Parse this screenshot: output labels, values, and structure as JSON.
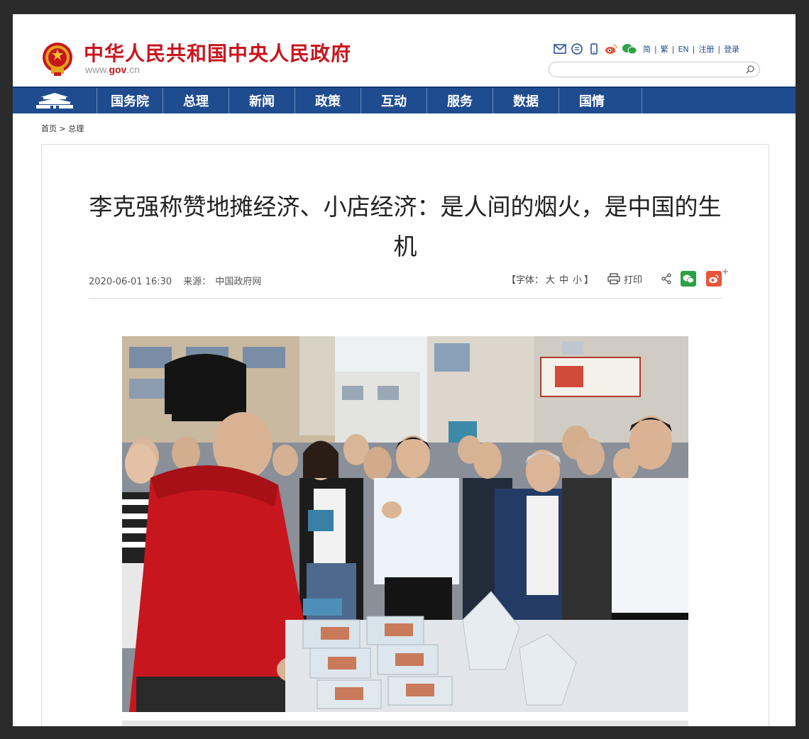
{
  "header": {
    "site_title": "中华人民共和国中央人民政府",
    "site_url_prefix": "www.",
    "site_url_gov": "gov",
    "site_url_suffix": ".cn",
    "tool_icons": [
      "mail-icon",
      "rss-icon",
      "mobile-icon",
      "weibo-icon",
      "wechat-icon"
    ],
    "links": [
      "简",
      "繁",
      "EN",
      "注册",
      "登录"
    ],
    "search_placeholder": ""
  },
  "nav": {
    "items": [
      "国务院",
      "总理",
      "新闻",
      "政策",
      "互动",
      "服务",
      "数据",
      "国情"
    ]
  },
  "breadcrumb": {
    "home": "首页",
    "sep": ">",
    "current": "总理"
  },
  "article": {
    "title": "李克强称赞地摊经济、小店经济：是人间的烟火，是中国的生机",
    "date": "2020-06-01 16:30",
    "source_label": "来源：",
    "source": "中国政府网",
    "font_label_open": "【字体：",
    "font_sizes": [
      "大",
      "中",
      "小"
    ],
    "font_label_close": "】",
    "print_label": "打印",
    "share_plus": "+"
  },
  "colors": {
    "brand_red": "#c8161e",
    "nav_blue": "#1f4b8f",
    "link_blue": "#224a8f",
    "wechat_green": "#2ba245",
    "weibo_orange": "#e8553a"
  }
}
